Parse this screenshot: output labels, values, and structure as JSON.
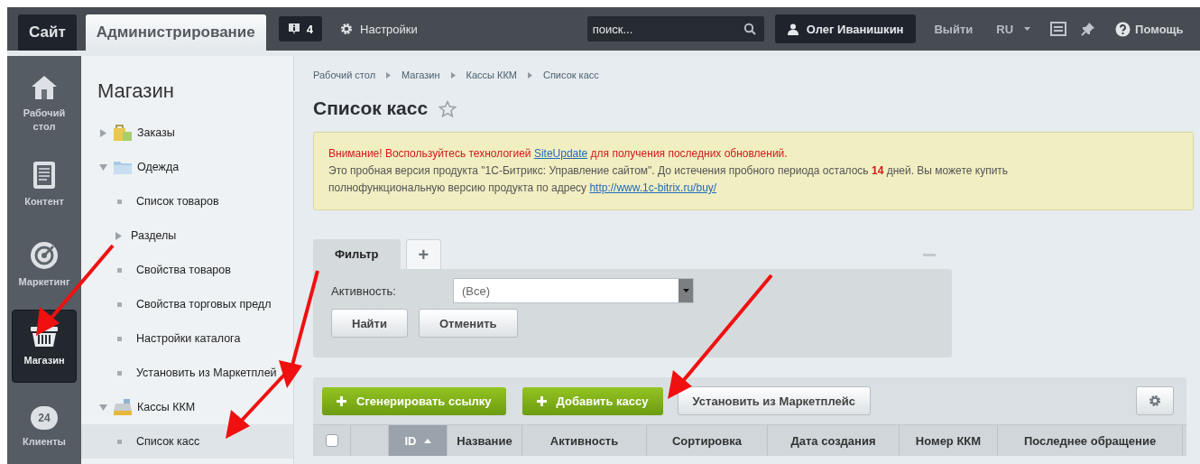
{
  "top_bar": {
    "tabs": [
      {
        "label": "Сайт",
        "selected": false
      },
      {
        "label": "Администрирование",
        "selected": true
      }
    ],
    "notifications": {
      "count": "4"
    },
    "settings": {
      "label": "Настройки"
    },
    "search": {
      "placeholder": "поиск..."
    },
    "user": {
      "name": "Олег Иванишкин"
    },
    "logout": {
      "label": "Выйти"
    },
    "language": {
      "label": "RU"
    },
    "help": {
      "label": "Помощь"
    }
  },
  "rail": {
    "items": [
      {
        "label": "Рабочий стол",
        "kind": "home",
        "selected": false
      },
      {
        "label": "Контент",
        "kind": "content",
        "selected": false
      },
      {
        "label": "Маркетинг",
        "kind": "marketing",
        "selected": false
      },
      {
        "label": "Магазин",
        "kind": "shop",
        "selected": true
      },
      {
        "label": "Клиенты",
        "kind": "clients",
        "badge": "24",
        "selected": false
      }
    ]
  },
  "sidebar": {
    "title": "Магазин",
    "items": [
      {
        "label": "Заказы",
        "kind": "bag",
        "expanded": false,
        "selected": false
      },
      {
        "label": "Одежда",
        "kind": "folder",
        "expanded": true,
        "selected": false,
        "children": [
          {
            "label": "Список товаров",
            "kind": "leaf",
            "selected": false
          },
          {
            "label": "Разделы",
            "kind": "branch",
            "expanded": false,
            "selected": false
          },
          {
            "label": "Свойства товаров",
            "kind": "leaf",
            "selected": false
          },
          {
            "label": "Свойства торговых предл",
            "kind": "leaf",
            "selected": false
          },
          {
            "label": "Настройки каталога",
            "kind": "leaf",
            "selected": false
          },
          {
            "label": "Установить из Маркетплей",
            "kind": "leaf",
            "selected": false
          }
        ]
      },
      {
        "label": "Кассы ККМ",
        "kind": "register",
        "expanded": true,
        "selected": false,
        "children": [
          {
            "label": "Список касс",
            "kind": "leaf",
            "selected": true
          }
        ]
      }
    ]
  },
  "breadcrumbs": [
    "Рабочий стол",
    "Магазин",
    "Кассы ККМ",
    "Список касс"
  ],
  "page_title": "Список касс",
  "notice": {
    "warning_before": "Внимание! Воспользуйтесь технологией ",
    "warning_link": "SiteUpdate",
    "warning_after": " для получения последних обновлений.",
    "trial_text": "Это пробная версия продукта \"1С-Битрикс: Управление сайтом\". До истечения пробного периода осталось **14** дней. Вы можете купить полнофункциональную версию продукта по адресу ",
    "trial_link": "http://www.1c-bitrix.ru/buy/"
  },
  "filter": {
    "tabs": [
      {
        "label": "Фильтр",
        "selected": true
      },
      {
        "label": "+",
        "selected": false
      }
    ],
    "fields": [
      {
        "label": "Активность:",
        "value": "(Все)"
      }
    ],
    "buttons": [
      "Найти",
      "Отменить"
    ]
  },
  "toolbar": {
    "buttons": [
      {
        "label": "Сгенерировать ссылку",
        "kind": "add"
      },
      {
        "label": "Добавить кассу",
        "kind": "add"
      },
      {
        "label": "Установить из Маркетплейс",
        "kind": "plain"
      }
    ]
  },
  "table": {
    "columns": [
      {
        "label": "ID",
        "sorted": true
      },
      {
        "label": "Название",
        "sorted": false
      },
      {
        "label": "Активность",
        "sorted": false
      },
      {
        "label": "Сортировка",
        "sorted": false
      },
      {
        "label": "Дата создания",
        "sorted": false
      },
      {
        "label": "Номер ККМ",
        "sorted": false
      },
      {
        "label": "Последнее обращение",
        "sorted": false
      }
    ],
    "select_all": {
      "checked": false
    }
  }
}
